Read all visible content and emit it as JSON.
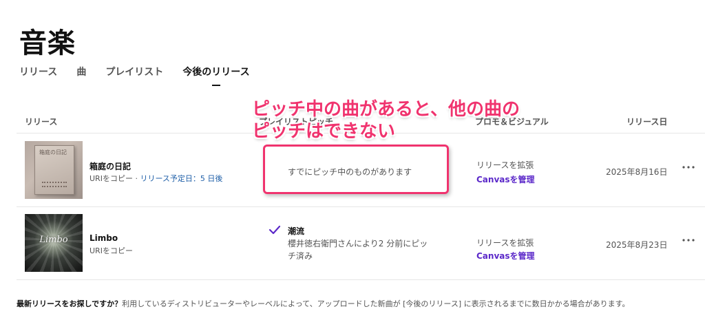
{
  "page_title": "音楽",
  "tabs": [
    {
      "label": "リリース"
    },
    {
      "label": "曲"
    },
    {
      "label": "プレイリスト"
    },
    {
      "label": "今後のリリース"
    }
  ],
  "table": {
    "headers": {
      "release": "リリース",
      "playlist": "プレイリストピッチ",
      "promo": "プロモ＆ビジュアル",
      "date": "リリース日"
    },
    "rows": [
      {
        "title": "箱庭の日記",
        "copy_uri": "URIをコピー",
        "separator": " · ",
        "scheduled": "リリース予定日：5 日後",
        "pitch_status": "すでにピッチ中のものがあります",
        "promo_extend": "リリースを拡張",
        "promo_canvas": "Canvasを管理",
        "release_date": "2025年8月16日",
        "cover_text": "箱庭の日記"
      },
      {
        "title": "Limbo",
        "copy_uri": "URIをコピー",
        "playlist_name": "潮流",
        "playlist_desc": "櫻井徳右衛門さんにより2 分前にピッチ済み",
        "promo_extend": "リリースを拡張",
        "promo_canvas": "Canvasを管理",
        "release_date": "2025年8月23日",
        "cover_text": "Limbo"
      }
    ]
  },
  "footer": {
    "bold": "最新リリースをお探しですか？",
    "text": "利用しているディストリビューターやレーベルによって、アップロードした新曲が [今後のリリース] に表示されるまでに数日かかる場合があります。"
  },
  "annotation": {
    "line1": "ピッチ中の曲があると、他の曲の",
    "line2": "ピッチはできない"
  },
  "colors": {
    "accent_purple": "#5b28c9",
    "link_blue": "#1f5fa8",
    "annotation_pink": "#f0336e"
  },
  "icons": {
    "check": "check-icon",
    "more": "more-horizontal-icon"
  }
}
